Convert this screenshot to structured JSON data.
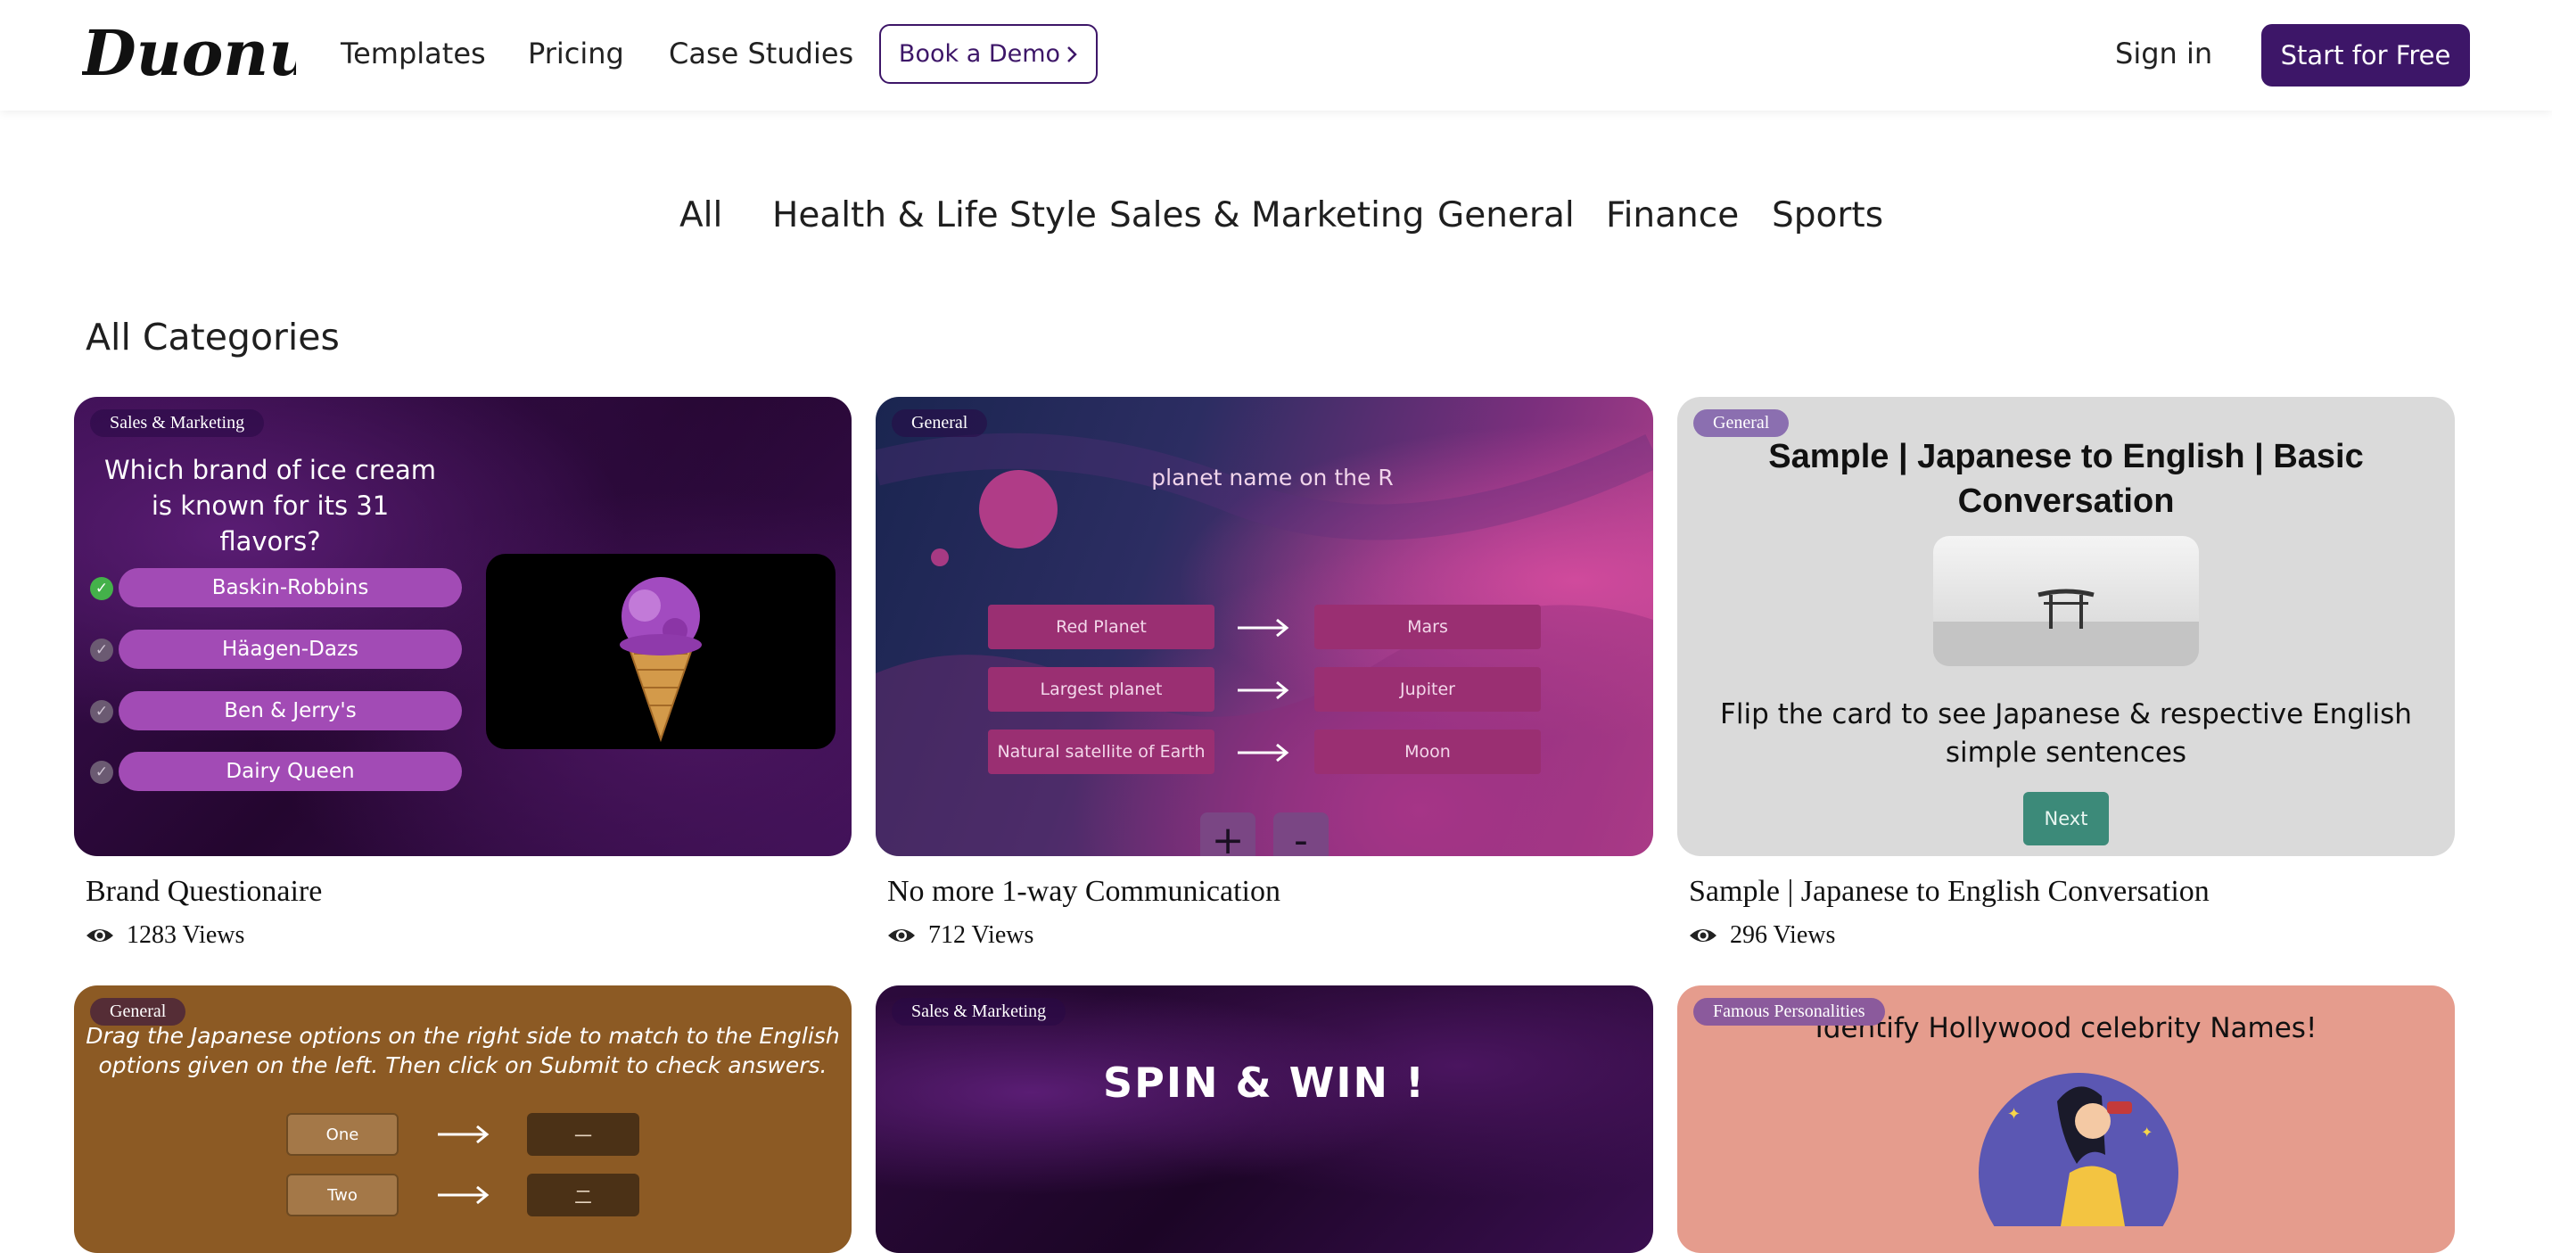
{
  "header": {
    "logo_text": "Duonut",
    "nav": [
      "Templates",
      "Pricing",
      "Case Studies"
    ],
    "demo_label": "Book a Demo",
    "signin_label": "Sign in",
    "start_label": "Start for Free"
  },
  "categories": [
    "All",
    "Health & Life Style",
    "Sales & Marketing",
    "General",
    "Finance",
    "Sports"
  ],
  "section_title": "All Categories",
  "cards": [
    {
      "tag": "Sales & Marketing",
      "title": "Brand Questionaire",
      "views": "1283 Views",
      "preview": {
        "question": "Which brand of ice cream is known for its 31 flavors?",
        "options": [
          "Baskin-Robbins",
          "Häagen-Dazs",
          "Ben & Jerry's",
          "Dairy Queen"
        ]
      }
    },
    {
      "tag": "General",
      "title": "No more 1-way Communication",
      "views": "712 Views",
      "preview": {
        "question": "planet name on the R",
        "left": [
          "Red Planet",
          "Largest planet",
          "Natural satellite of Earth"
        ],
        "right": [
          "Mars",
          "Jupiter",
          "Moon"
        ],
        "plus": "+",
        "minus": "-"
      }
    },
    {
      "tag": "General",
      "title": "Sample | Japanese to English Conversation",
      "views": "296 Views",
      "preview": {
        "heading": "Sample | Japanese to English | Basic Conversation",
        "text": "Flip the card to see Japanese & respective English simple sentences",
        "button": "Next"
      }
    },
    {
      "tag": "General",
      "preview": {
        "text": "Drag the Japanese options on the right side to match to the English options given on the left. Then click on Submit to check answers.",
        "left": [
          "One",
          "Two"
        ],
        "right": [
          "一",
          "二"
        ]
      }
    },
    {
      "tag": "Sales & Marketing",
      "preview": {
        "heading": "SPIN & WIN !"
      }
    },
    {
      "tag": "Famous Personalities",
      "preview": {
        "heading": "Identify Hollywood celebrity Names!"
      }
    }
  ],
  "colors": {
    "brand": "#3d1668",
    "check": "#44b14a"
  }
}
